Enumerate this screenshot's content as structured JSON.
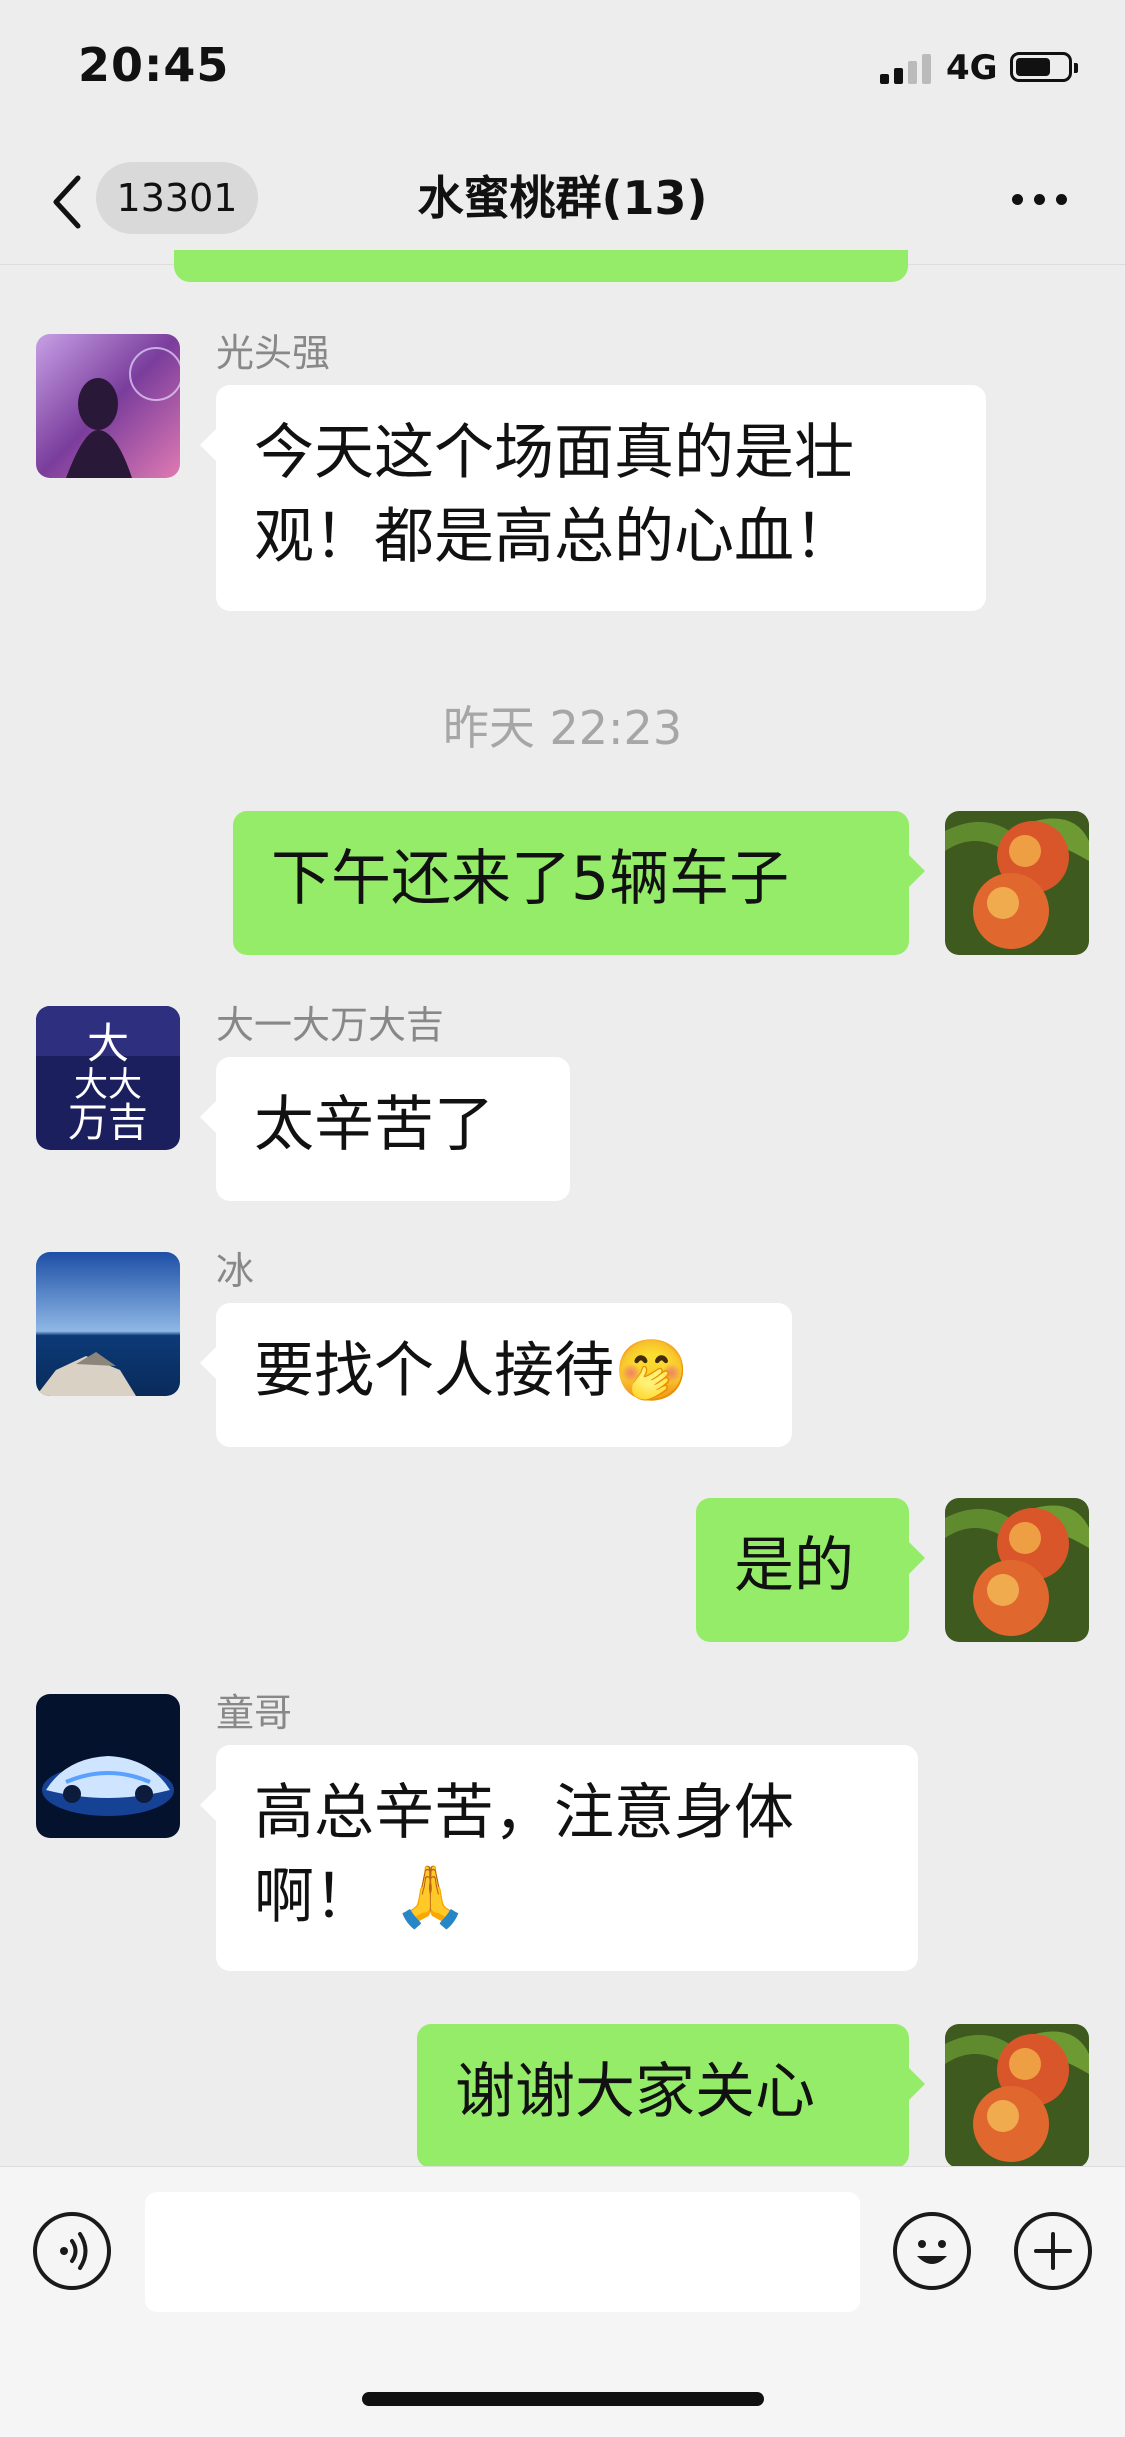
{
  "status_bar": {
    "time": "20:45",
    "network": "4G"
  },
  "nav": {
    "unread_count": "13301",
    "title": "水蜜桃群(13)"
  },
  "messages": [
    {
      "side": "left",
      "sender": "光头强",
      "lines": [
        "今天这个场面真的是壮",
        "观！都是高总的心血！"
      ]
    },
    {
      "timestamp": "昨天 22:23"
    },
    {
      "side": "right",
      "text": "下午还来了5辆车子"
    },
    {
      "side": "left",
      "sender": "大一大万大吉",
      "text": "太辛苦了"
    },
    {
      "side": "left",
      "sender": "冰",
      "text": "要找个人接待🤭"
    },
    {
      "side": "right",
      "text": "是的"
    },
    {
      "side": "left",
      "sender": "童哥",
      "lines": [
        "高总辛苦，注意身体",
        "啊！ 🙏"
      ]
    },
    {
      "side": "right",
      "text": "谢谢大家关心"
    }
  ],
  "avatar_labels": {
    "dayidawan": "大\n大大\n万吉"
  },
  "icons": [
    "back-chevron-icon",
    "more-dots-icon",
    "voice-icon",
    "emoji-icon",
    "plus-icon"
  ],
  "colors": {
    "background": "#ededed",
    "own_bubble": "#95ec69",
    "other_bubble": "#ffffff"
  }
}
